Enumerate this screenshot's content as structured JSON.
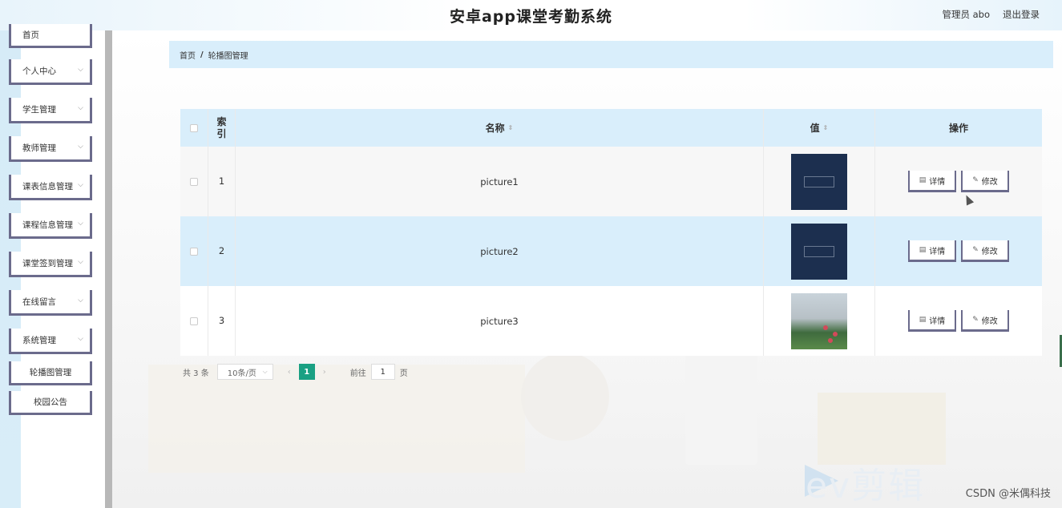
{
  "header": {
    "title": "安卓app课堂考勤系统",
    "user_label": "管理员 abo",
    "logout_label": "退出登录"
  },
  "sidebar": {
    "items": [
      {
        "label": "首页"
      },
      {
        "label": "个人中心"
      },
      {
        "label": "学生管理"
      },
      {
        "label": "教师管理"
      },
      {
        "label": "课表信息管理"
      },
      {
        "label": "课程信息管理"
      },
      {
        "label": "课堂签到管理"
      },
      {
        "label": "在线留言"
      },
      {
        "label": "系统管理"
      }
    ],
    "sub_items": [
      {
        "label": "轮播图管理"
      },
      {
        "label": "校园公告"
      }
    ]
  },
  "breadcrumb": {
    "home": "首页",
    "separator": "/",
    "current": "轮播图管理"
  },
  "table": {
    "headers": {
      "index_line1": "索",
      "index_line2": "引",
      "name": "名称",
      "value": "值",
      "actions": "操作"
    },
    "rows": [
      {
        "index": "1",
        "name": "picture1",
        "image": "dark-logo"
      },
      {
        "index": "2",
        "name": "picture2",
        "image": "dark-logo"
      },
      {
        "index": "3",
        "name": "picture3",
        "image": "campus-photo"
      }
    ],
    "detail_label": "详情",
    "edit_label": "修改"
  },
  "pagination": {
    "total": "共 3 条",
    "page_size": "10条/页",
    "current_page": "1",
    "goto_label": "前往",
    "goto_value": "1",
    "page_suffix": "页"
  },
  "watermarks": {
    "ev": "ev剪辑",
    "csdn": "CSDN @米偶科技"
  },
  "colors": {
    "accent_light_blue": "#d9eefb",
    "pager_active": "#1aa083",
    "button_border": "#6b6b8c"
  }
}
